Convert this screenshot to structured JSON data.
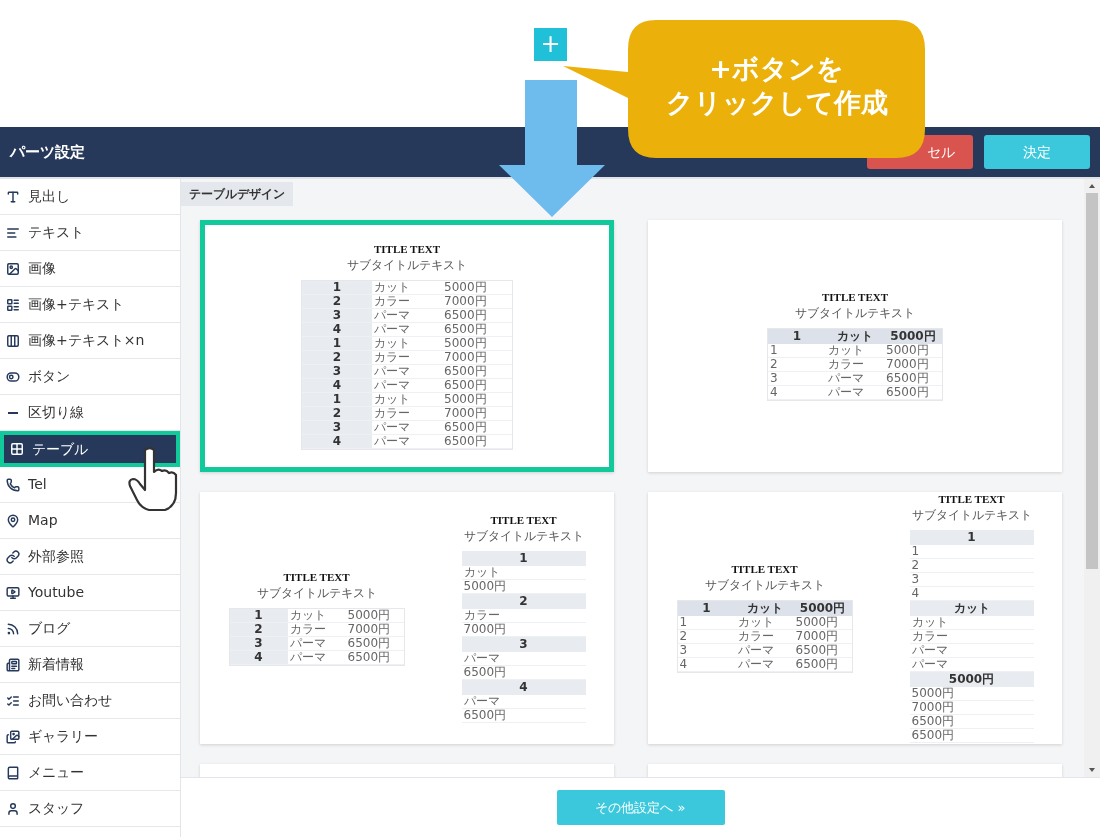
{
  "callout": {
    "plus_button": "+",
    "lines": [
      "+ボタンを",
      "クリックして作成"
    ]
  },
  "header": {
    "title": "パーツ設定",
    "buttons": [
      {
        "kind": "cancel",
        "label": "セル"
      },
      {
        "kind": "confirm",
        "label": "決定"
      }
    ]
  },
  "sidebar": {
    "items": [
      {
        "label": "見出し",
        "selected": false
      },
      {
        "label": "テキスト",
        "selected": false
      },
      {
        "label": "画像",
        "selected": false
      },
      {
        "label": "画像+テキスト",
        "selected": false
      },
      {
        "label": "画像+テキスト×n",
        "selected": false
      },
      {
        "label": "ボタン",
        "selected": false
      },
      {
        "label": "区切り線",
        "selected": false
      },
      {
        "label": "テーブル",
        "selected": true
      },
      {
        "label": "Tel",
        "selected": false
      },
      {
        "label": "Map",
        "selected": false
      },
      {
        "label": "外部参照",
        "selected": false
      },
      {
        "label": "Youtube",
        "selected": false
      },
      {
        "label": "ブログ",
        "selected": false
      },
      {
        "label": "新着情報",
        "selected": false
      },
      {
        "label": "お問い合わせ",
        "selected": false
      },
      {
        "label": "ギャラリー",
        "selected": false
      },
      {
        "label": "メニュー",
        "selected": false
      },
      {
        "label": "スタッフ",
        "selected": false
      }
    ]
  },
  "section_tab": "テーブルデザイン",
  "cards": [
    {
      "selected": true,
      "previews": [
        {
          "kind": "side-header",
          "title": "TITLE TEXT",
          "subtitle": "サブタイトルテキスト",
          "rows": [
            [
              "1",
              "カット",
              "5000円"
            ],
            [
              "2",
              "カラー",
              "7000円"
            ],
            [
              "3",
              "パーマ",
              "6500円"
            ],
            [
              "4",
              "パーマ",
              "6500円"
            ],
            [
              "1",
              "カット",
              "5000円"
            ],
            [
              "2",
              "カラー",
              "7000円"
            ],
            [
              "3",
              "パーマ",
              "6500円"
            ],
            [
              "4",
              "パーマ",
              "6500円"
            ],
            [
              "1",
              "カット",
              "5000円"
            ],
            [
              "2",
              "カラー",
              "7000円"
            ],
            [
              "3",
              "パーマ",
              "6500円"
            ],
            [
              "4",
              "パーマ",
              "6500円"
            ]
          ]
        }
      ]
    },
    {
      "selected": false,
      "previews": [
        {
          "kind": "top-header",
          "title": "TITLE TEXT",
          "subtitle": "サブタイトルテキスト",
          "header": [
            "1",
            "カット",
            "5000円"
          ],
          "rows": [
            [
              "1",
              "カット",
              "5000円"
            ],
            [
              "2",
              "カラー",
              "7000円"
            ],
            [
              "3",
              "パーマ",
              "6500円"
            ],
            [
              "4",
              "パーマ",
              "6500円"
            ]
          ]
        }
      ]
    },
    {
      "selected": false,
      "previews": [
        {
          "kind": "side-header",
          "title": "TITLE TEXT",
          "subtitle": "サブタイトルテキスト",
          "rows": [
            [
              "1",
              "カット",
              "5000円"
            ],
            [
              "2",
              "カラー",
              "7000円"
            ],
            [
              "3",
              "パーマ",
              "6500円"
            ],
            [
              "4",
              "パーマ",
              "6500円"
            ]
          ]
        },
        {
          "kind": "stacked",
          "title": "TITLE TEXT",
          "subtitle": "サブタイトルテキスト",
          "sections": [
            {
              "heading": "1",
              "items": [
                "カット",
                "5000円"
              ]
            },
            {
              "heading": "2",
              "items": [
                "カラー",
                "7000円"
              ]
            },
            {
              "heading": "3",
              "items": [
                "パーマ",
                "6500円"
              ]
            },
            {
              "heading": "4",
              "items": [
                "パーマ",
                "6500円"
              ]
            }
          ]
        }
      ]
    },
    {
      "selected": false,
      "previews": [
        {
          "kind": "top-header",
          "title": "TITLE TEXT",
          "subtitle": "サブタイトルテキスト",
          "header": [
            "1",
            "カット",
            "5000円"
          ],
          "rows": [
            [
              "1",
              "カット",
              "5000円"
            ],
            [
              "2",
              "カラー",
              "7000円"
            ],
            [
              "3",
              "パーマ",
              "6500円"
            ],
            [
              "4",
              "パーマ",
              "6500円"
            ]
          ]
        },
        {
          "kind": "stacked",
          "title": "TITLE TEXT",
          "subtitle": "サブタイトルテキスト",
          "sections": [
            {
              "heading": "1",
              "items": [
                "1",
                "2",
                "3",
                "4"
              ]
            },
            {
              "heading": "カット",
              "items": [
                "カット",
                "カラー",
                "パーマ",
                "パーマ"
              ]
            },
            {
              "heading": "5000円",
              "items": [
                "5000円",
                "7000円",
                "6500円",
                "6500円"
              ]
            }
          ]
        }
      ]
    },
    {
      "selected": false
    },
    {
      "selected": false
    }
  ],
  "footer": {
    "button": "その他設定へ »"
  }
}
